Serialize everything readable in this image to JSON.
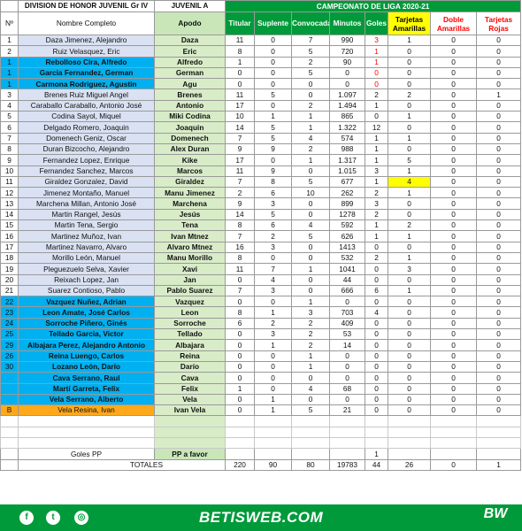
{
  "header": {
    "division": "DIVISION DE HONOR JUVENIL Gr IV",
    "team": "JUVENIL A",
    "campaign": "CAMPEONATO  DE LIGA 2020-21",
    "col_no": "Nº",
    "col_name": "Nombre Completo",
    "col_apodo": "Apodo",
    "col_titular": "Titular",
    "col_suplente": "Suplente",
    "col_convocada": "Convocada",
    "col_minutos": "Minutos",
    "col_goles": "Goles",
    "col_amarillas": "Tarjetas Amarillas",
    "col_doble": "Doble Amarillas",
    "col_rojas": "Tarjetas Rojas"
  },
  "players": [
    {
      "no": "1",
      "name": "Daza Jimenez, Alejandro",
      "apodo": "Daza",
      "tit": "11",
      "sup": "0",
      "conv": "7",
      "min": "990",
      "gol": "3",
      "am": "1",
      "da": "0",
      "ro": "0",
      "style": "",
      "golred": true
    },
    {
      "no": "2",
      "name": "Ruiz Velasquez, Eric",
      "apodo": "Eric",
      "tit": "8",
      "sup": "0",
      "conv": "5",
      "min": "720",
      "gol": "1",
      "am": "0",
      "da": "0",
      "ro": "0",
      "style": "",
      "golred": true
    },
    {
      "no": "1",
      "name": "Rebolloso Cira, Alfredo",
      "apodo": "Alfredo",
      "tit": "1",
      "sup": "0",
      "conv": "2",
      "min": "90",
      "gol": "1",
      "am": "0",
      "da": "0",
      "ro": "0",
      "style": "cyan",
      "golred": true
    },
    {
      "no": "1",
      "name": "Garcia Fernandez, German",
      "apodo": "German",
      "tit": "0",
      "sup": "0",
      "conv": "5",
      "min": "0",
      "gol": "0",
      "am": "0",
      "da": "0",
      "ro": "0",
      "style": "cyan",
      "golred": true
    },
    {
      "no": "1",
      "name": "Carmona Rodriguez, Agustin",
      "apodo": "Agu",
      "tit": "0",
      "sup": "0",
      "conv": "0",
      "min": "0",
      "gol": "0",
      "am": "0",
      "da": "0",
      "ro": "0",
      "style": "cyan",
      "golred": true
    },
    {
      "no": "3",
      "name": "Brenes Ruiz Miguel Angel",
      "apodo": "Brenes",
      "tit": "11",
      "sup": "5",
      "conv": "0",
      "min": "1.097",
      "gol": "2",
      "am": "2",
      "da": "0",
      "ro": "1",
      "style": ""
    },
    {
      "no": "4",
      "name": "Caraballo Caraballo, Antonio José",
      "apodo": "Antonio",
      "tit": "17",
      "sup": "0",
      "conv": "2",
      "min": "1.494",
      "gol": "1",
      "am": "0",
      "da": "0",
      "ro": "0",
      "style": ""
    },
    {
      "no": "5",
      "name": "Codina Sayol, Miquel",
      "apodo": "Miki Codina",
      "tit": "10",
      "sup": "1",
      "conv": "1",
      "min": "865",
      "gol": "0",
      "am": "1",
      "da": "0",
      "ro": "0",
      "style": ""
    },
    {
      "no": "6",
      "name": "Delgado Romero, Joaquin",
      "apodo": "Joaquin",
      "tit": "14",
      "sup": "5",
      "conv": "1",
      "min": "1.322",
      "gol": "12",
      "am": "0",
      "da": "0",
      "ro": "0",
      "style": ""
    },
    {
      "no": "7",
      "name": "Domenech Geniz, Oscar",
      "apodo": "Domenech",
      "tit": "7",
      "sup": "5",
      "conv": "4",
      "min": "574",
      "gol": "1",
      "am": "1",
      "da": "0",
      "ro": "0",
      "style": ""
    },
    {
      "no": "8",
      "name": "Duran Bizcocho, Alejandro",
      "apodo": "Alex Duran",
      "tit": "9",
      "sup": "9",
      "conv": "2",
      "min": "988",
      "gol": "1",
      "am": "0",
      "da": "0",
      "ro": "0",
      "style": ""
    },
    {
      "no": "9",
      "name": "Fernandez Lopez, Enrique",
      "apodo": "Kike",
      "tit": "17",
      "sup": "0",
      "conv": "1",
      "min": "1.317",
      "gol": "1",
      "am": "5",
      "da": "0",
      "ro": "0",
      "style": ""
    },
    {
      "no": "10",
      "name": "Fernandez Sanchez, Marcos",
      "apodo": "Marcos",
      "tit": "11",
      "sup": "9",
      "conv": "0",
      "min": "1.015",
      "gol": "3",
      "am": "1",
      "da": "0",
      "ro": "0",
      "style": ""
    },
    {
      "no": "11",
      "name": "Giraldez Gonzalez, David",
      "apodo": "Giraldez",
      "tit": "7",
      "sup": "8",
      "conv": "5",
      "min": "677",
      "gol": "1",
      "am": "4",
      "da": "0",
      "ro": "0",
      "style": "",
      "amy": true
    },
    {
      "no": "12",
      "name": "Jimenez  Montaño, Manuel",
      "apodo": "Manu Jimenez",
      "tit": "2",
      "sup": "6",
      "conv": "10",
      "min": "262",
      "gol": "2",
      "am": "1",
      "da": "0",
      "ro": "0",
      "style": ""
    },
    {
      "no": "13",
      "name": "Marchena Millan, Antonio José",
      "apodo": "Marchena",
      "tit": "9",
      "sup": "3",
      "conv": "0",
      "min": "899",
      "gol": "3",
      "am": "0",
      "da": "0",
      "ro": "0",
      "style": ""
    },
    {
      "no": "14",
      "name": "Martin Rangel, Jesús",
      "apodo": "Jesús",
      "tit": "14",
      "sup": "5",
      "conv": "0",
      "min": "1278",
      "gol": "2",
      "am": "0",
      "da": "0",
      "ro": "0",
      "style": ""
    },
    {
      "no": "15",
      "name": "Martin Tena, Sergio",
      "apodo": "Tena",
      "tit": "8",
      "sup": "6",
      "conv": "4",
      "min": "592",
      "gol": "1",
      "am": "2",
      "da": "0",
      "ro": "0",
      "style": ""
    },
    {
      "no": "16",
      "name": "Martinez Muñoz, Ivan",
      "apodo": "Ivan Mtnez",
      "tit": "7",
      "sup": "2",
      "conv": "5",
      "min": "626",
      "gol": "1",
      "am": "1",
      "da": "0",
      "ro": "0",
      "style": ""
    },
    {
      "no": "17",
      "name": "Martinez Navarro, Alvaro",
      "apodo": "Alvaro Mtnez",
      "tit": "16",
      "sup": "3",
      "conv": "0",
      "min": "1413",
      "gol": "0",
      "am": "0",
      "da": "0",
      "ro": "0",
      "style": ""
    },
    {
      "no": "18",
      "name": "Morillo León, Manuel",
      "apodo": "Manu Morillo",
      "tit": "8",
      "sup": "0",
      "conv": "0",
      "min": "532",
      "gol": "2",
      "am": "1",
      "da": "0",
      "ro": "0",
      "style": ""
    },
    {
      "no": "19",
      "name": "Pleguezuelo Selva, Xavier",
      "apodo": "Xavi",
      "tit": "11",
      "sup": "7",
      "conv": "1",
      "min": "1041",
      "gol": "0",
      "am": "3",
      "da": "0",
      "ro": "0",
      "style": ""
    },
    {
      "no": "20",
      "name": "Reixach Lopez, Jan",
      "apodo": "Jan",
      "tit": "0",
      "sup": "4",
      "conv": "0",
      "min": "44",
      "gol": "0",
      "am": "0",
      "da": "0",
      "ro": "0",
      "style": ""
    },
    {
      "no": "21",
      "name": "Suarez Contioso, Pablo",
      "apodo": "Pablo Suarez",
      "tit": "7",
      "sup": "3",
      "conv": "0",
      "min": "666",
      "gol": "6",
      "am": "1",
      "da": "0",
      "ro": "0",
      "style": ""
    },
    {
      "no": "22",
      "name": "Vazquez Nuñez, Adrian",
      "apodo": "Vazquez",
      "tit": "0",
      "sup": "0",
      "conv": "1",
      "min": "0",
      "gol": "0",
      "am": "0",
      "da": "0",
      "ro": "0",
      "style": "cyan"
    },
    {
      "no": "23",
      "name": "Leon Amate, José Carlos",
      "apodo": "Leon",
      "tit": "8",
      "sup": "1",
      "conv": "3",
      "min": "703",
      "gol": "4",
      "am": "0",
      "da": "0",
      "ro": "0",
      "style": "cyan"
    },
    {
      "no": "24",
      "name": "Sorroche Piñero, Ginés",
      "apodo": "Sorroche",
      "tit": "6",
      "sup": "2",
      "conv": "2",
      "min": "409",
      "gol": "0",
      "am": "0",
      "da": "0",
      "ro": "0",
      "style": "cyan"
    },
    {
      "no": "25",
      "name": "Tellado Garcia, Victor",
      "apodo": "Tellado",
      "tit": "0",
      "sup": "3",
      "conv": "2",
      "min": "53",
      "gol": "0",
      "am": "0",
      "da": "0",
      "ro": "0",
      "style": "cyan"
    },
    {
      "no": "29",
      "name": "Albajara Perez, Alejandro Antonio",
      "apodo": "Albajara",
      "tit": "0",
      "sup": "1",
      "conv": "2",
      "min": "14",
      "gol": "0",
      "am": "0",
      "da": "0",
      "ro": "0",
      "style": "cyan"
    },
    {
      "no": "26",
      "name": "Reina Luengo, Carlos",
      "apodo": "Reina",
      "tit": "0",
      "sup": "0",
      "conv": "1",
      "min": "0",
      "gol": "0",
      "am": "0",
      "da": "0",
      "ro": "0",
      "style": "cyan"
    },
    {
      "no": "30",
      "name": "Lozano León, Darío",
      "apodo": "Darío",
      "tit": "0",
      "sup": "0",
      "conv": "1",
      "min": "0",
      "gol": "0",
      "am": "0",
      "da": "0",
      "ro": "0",
      "style": "cyan"
    },
    {
      "no": "",
      "name": "Cava Serrano, Raul",
      "apodo": "Cava",
      "tit": "0",
      "sup": "0",
      "conv": "0",
      "min": "0",
      "gol": "0",
      "am": "0",
      "da": "0",
      "ro": "0",
      "style": "cyan"
    },
    {
      "no": "",
      "name": "Martí  Garreta, Felix",
      "apodo": "Felix",
      "tit": "1",
      "sup": "0",
      "conv": "4",
      "min": "68",
      "gol": "0",
      "am": "0",
      "da": "0",
      "ro": "0",
      "style": "cyan"
    },
    {
      "no": "",
      "name": "Vela Serrano, Alberto",
      "apodo": "Vela",
      "tit": "0",
      "sup": "1",
      "conv": "0",
      "min": "0",
      "gol": "0",
      "am": "0",
      "da": "0",
      "ro": "0",
      "style": "cyan"
    },
    {
      "no": "B",
      "name": "Vela Resina, Ivan",
      "apodo": "Ivan Vela",
      "tit": "0",
      "sup": "1",
      "conv": "5",
      "min": "21",
      "gol": "0",
      "am": "0",
      "da": "0",
      "ro": "0",
      "style": "orange"
    }
  ],
  "summary": {
    "goles_pp_label": "Goles PP",
    "pp_label": "PP a favor",
    "pp_goles": "1",
    "totales_label": "TOTALES",
    "tit": "220",
    "sup": "90",
    "conv": "80",
    "min": "19783",
    "gol": "44",
    "am": "26",
    "da": "0",
    "ro": "1"
  },
  "footer": {
    "social_icons": [
      "facebook-icon",
      "twitter-icon",
      "instagram-icon"
    ],
    "facebook_glyph": "f",
    "twitter_glyph": "t",
    "instagram_glyph": "◎",
    "brand": "BETISWEB.COM",
    "logo_text": "BW",
    "brand_color": "#009a3a"
  },
  "colors": {
    "green": "#009a3a",
    "cyan": "#00b0f0",
    "orange": "#ffa91a",
    "yellow": "#ffff00",
    "name_bg": "#d9e1f2",
    "apodo_bg": "#d8ecc8"
  }
}
